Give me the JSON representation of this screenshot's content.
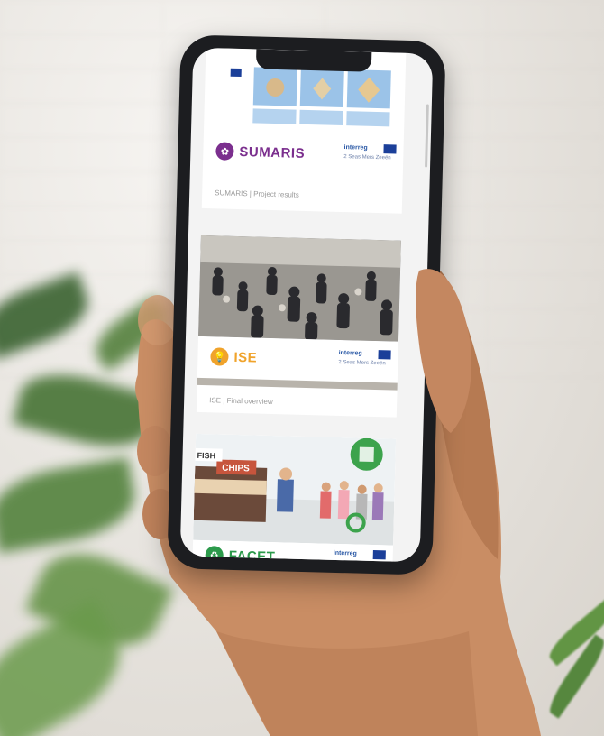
{
  "cards": [
    {
      "name": "SUMARIS",
      "caption": "SUMARIS | Project results",
      "color": "#7b2f8e"
    },
    {
      "name": "ISE",
      "caption": "ISE | Final overview",
      "color": "#f0a32b"
    },
    {
      "name": "FACET",
      "caption": "",
      "color": "#2c9a4b"
    }
  ],
  "interreg": {
    "brand": "interreg",
    "region": "2 Seas Mers Zeeën"
  },
  "illustration": {
    "fish_sign": "FISH",
    "chips_sign": "CHIPS"
  },
  "colors": {
    "phone": "#1c1d20",
    "screen": "#f3f3f3",
    "brand_blue": "#2857a5"
  }
}
